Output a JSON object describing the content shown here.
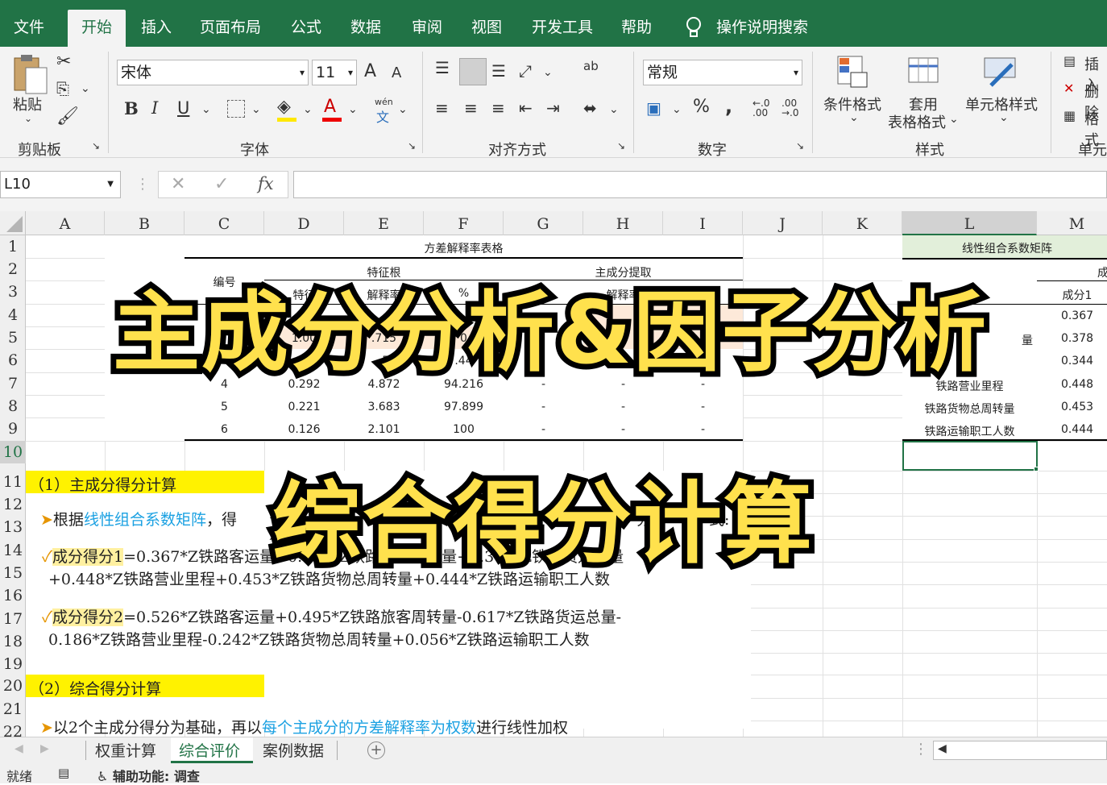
{
  "ribbon_tabs": [
    "文件",
    "开始",
    "插入",
    "页面布局",
    "公式",
    "数据",
    "审阅",
    "视图",
    "开发工具",
    "帮助"
  ],
  "tell_me": "操作说明搜索",
  "clipboard": {
    "paste": "粘贴",
    "group": "剪贴板"
  },
  "font": {
    "name": "宋体",
    "size": "11",
    "group": "字体",
    "grow": "A",
    "shrink": "A",
    "bold": "B",
    "italic": "I",
    "underline": "U",
    "wen": "wén",
    "wen_char": "文"
  },
  "alignment": {
    "group": "对齐方式",
    "ab": "ab"
  },
  "number": {
    "format": "常规",
    "group": "数字",
    "percent": "%",
    "comma": ",",
    "inc": "←.0\n.00",
    "dec": ".00\n→.0"
  },
  "styles": {
    "conditional": "条件格式",
    "table_l1": "套用",
    "table_l2": "表格格式",
    "cell": "单元格样式",
    "group": "样式"
  },
  "cells": {
    "insert": "插入",
    "delete": "删除",
    "format": "格式",
    "group": "单元"
  },
  "name_box": "L10",
  "fx": "fx",
  "columns": [
    "A",
    "B",
    "C",
    "D",
    "E",
    "F",
    "G",
    "H",
    "I",
    "J",
    "K",
    "L",
    "M"
  ],
  "rows": [
    "1",
    "2",
    "3",
    "4",
    "5",
    "6",
    "7",
    "8",
    "9",
    "10",
    "11",
    "12",
    "13",
    "14",
    "15",
    "16",
    "17",
    "18",
    "19",
    "20",
    "21",
    "22"
  ],
  "table1": {
    "title": "方差解释率表格",
    "h_eigen": "特征根",
    "h_extract": "主成分提取",
    "c2": "编号",
    "c3": "特征",
    "c4": "解释率",
    "c5": "%",
    "c6": "解释率",
    "r4": [
      "1",
      "1.00",
      "",
      "0",
      ""
    ],
    "r5": [
      "2",
      "1.00",
      ".715",
      "0"
    ],
    "rows": [
      [
        "4",
        "0.292",
        "4.872",
        "94.216",
        "-",
        "-",
        "-"
      ],
      [
        "5",
        "0.221",
        "3.683",
        "97.899",
        "-",
        "-",
        "-"
      ],
      [
        "6",
        "0.126",
        "2.101",
        "100",
        "-",
        "-",
        "-"
      ]
    ],
    "r6": [
      ".5",
      ".44"
    ]
  },
  "table2": {
    "title": "线性组合系数矩阵",
    "header": "成分1",
    "m2": "成",
    "values": [
      "0.367",
      "0.378",
      "0.344",
      "0.448",
      "0.453",
      "0.444"
    ],
    "labels": [
      "量",
      "铁路营业里程",
      "铁路货物总周转量",
      "铁路运输职工人数"
    ]
  },
  "notes": {
    "s1": "（1）主成分得分计算",
    "l1a": "根据",
    "l1b": "线性组合系数矩阵",
    "l1c": "，得",
    "l1d": "分",
    "l1e": "式:",
    "l2_hl": "成分得分1",
    "l2": "=0.367*Z铁路客运量+0.378*Z铁路旅客周转量+0.344*Z铁路货运总量",
    "l3": "+0.448*Z铁路营业里程+0.453*Z铁路货物总周转量+0.444*Z铁路运输职工人数",
    "l4_hl": "成分得分2",
    "l4": "=0.526*Z铁路客运量+0.495*Z铁路旅客周转量-0.617*Z铁路货运总量-",
    "l5": "0.186*Z铁路营业里程-0.242*Z铁路货物总周转量+0.056*Z铁路运输职工人数",
    "s2": "（2）综合得分计算",
    "l6a": "以2个主成分得分为基础，再以",
    "l6b": "每个主成分的方差解释率为权数",
    "l6c": "进行线性加权"
  },
  "overlay": {
    "line1": "主成分分析&因子分析",
    "line2": "综合得分计算"
  },
  "sheets": [
    "权重计算",
    "综合评价",
    "案例数据"
  ],
  "status": {
    "ready": "就绪",
    "accessibility": "辅助功能: 调查"
  },
  "colors": {
    "excel_green": "#217346",
    "highlight": "#fff200",
    "link": "#1ba1e2",
    "table2_header": "#e2efda"
  }
}
